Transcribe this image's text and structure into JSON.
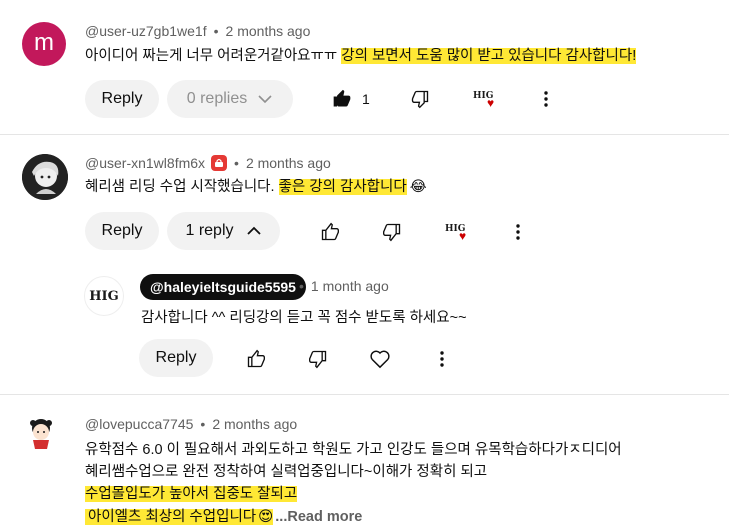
{
  "comments": [
    {
      "avatar_letter": "m",
      "avatar_color": "#c2185b",
      "handle": "@user-uz7gb1we1f",
      "time": "2 months ago",
      "text_plain": "아이디어 짜는게 너무 어려운거같아요ㅠㅠ ",
      "text_highlight": "강의 보면서 도움 많이 받고 있습니다 감사합니다!",
      "reply_label": "Reply",
      "replies_label": "0 replies",
      "like_count": "1"
    },
    {
      "handle": "@user-xn1wl8fm6x",
      "time": "2 months ago",
      "text_plain": "혜리샘 리딩 수업 시작했습니다. ",
      "text_highlight": "좋은 강의 감사합니다",
      "text_emoji": "😂",
      "reply_label": "Reply",
      "replies_label": "1 reply"
    },
    {
      "handle": "@lovepucca7745",
      "time": "2 months ago",
      "line1": "유학점수 6.0 이 필요해서 과외도하고 학원도 가고 인강도 들으며 유목학습하다가ㅈ디디어",
      "line2": "혜리쌤수업으로 완전 정착하여 실력업중입니다~이해가 정확히 되고",
      "line3": "수업몰입도가 높아서 집중도 잘되고",
      "line4": "아이엘츠 최상의 수업입니다",
      "line4_emoji": "😍",
      "read_more": "...Read more"
    }
  ],
  "reply": {
    "channel": "@haleyieltsguide5595",
    "time": "1 month ago",
    "text": "감사합니다 ^^ 리딩강의 듣고 꼭 점수 받도록 하세요~~",
    "reply_label": "Reply"
  },
  "creator_badge_text": "HIG",
  "logo_text": "HIG",
  "colors": {
    "highlight": "#ffe835",
    "pill_bg": "#f2f2f2",
    "heart": "#cc0000"
  }
}
